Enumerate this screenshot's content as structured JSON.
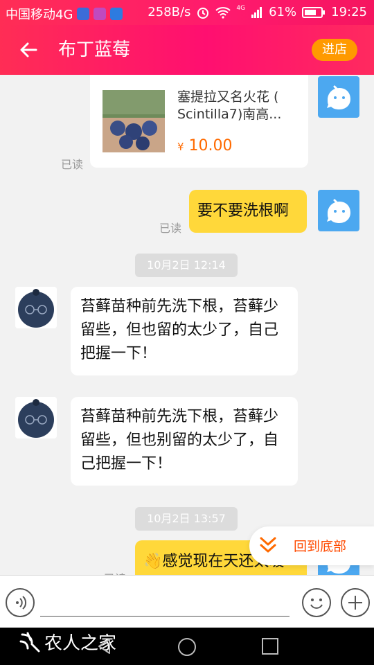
{
  "status_bar": {
    "carrier": "中国移动4G",
    "net_speed": "258B/s",
    "battery_pct": "61%",
    "time": "19:25",
    "network_badge": "4G"
  },
  "header": {
    "back_icon": "back-arrow-icon",
    "title": "布丁蓝莓",
    "shop_button": "进店"
  },
  "messages": {
    "product": {
      "title": "塞提拉又名火花 ( Scintilla7)南高...",
      "currency": "¥",
      "price": "10.00",
      "read_label": "已读"
    },
    "me1": {
      "text": "要不要洗根啊",
      "read_label": "已读"
    },
    "time1": "10月2日 12:14",
    "seller1": {
      "text": "苔藓苗种前先洗下根，苔藓少留些，但也留的太少了，自己把握一下！"
    },
    "seller2": {
      "text": "苔藓苗种前先洗下根，苔藓少留些，但也别留的太少了，自己把握一下！"
    },
    "time2": "10月2日 13:57",
    "me2": {
      "text": "感觉现在天还太暖",
      "read_label": "已读"
    }
  },
  "scroll_bottom": {
    "label": "回到底部"
  },
  "input_bar": {
    "voice_icon": "voice-icon",
    "emoji_icon": "emoji-icon",
    "plus_icon": "plus-icon"
  },
  "watermark": "农人之家",
  "colors": {
    "header": "#ff1a6e",
    "shop_button": "#ff9a00",
    "my_bubble": "#ffd83a",
    "price": "#ff6a00",
    "avatar_me": "#4ca8f0"
  }
}
